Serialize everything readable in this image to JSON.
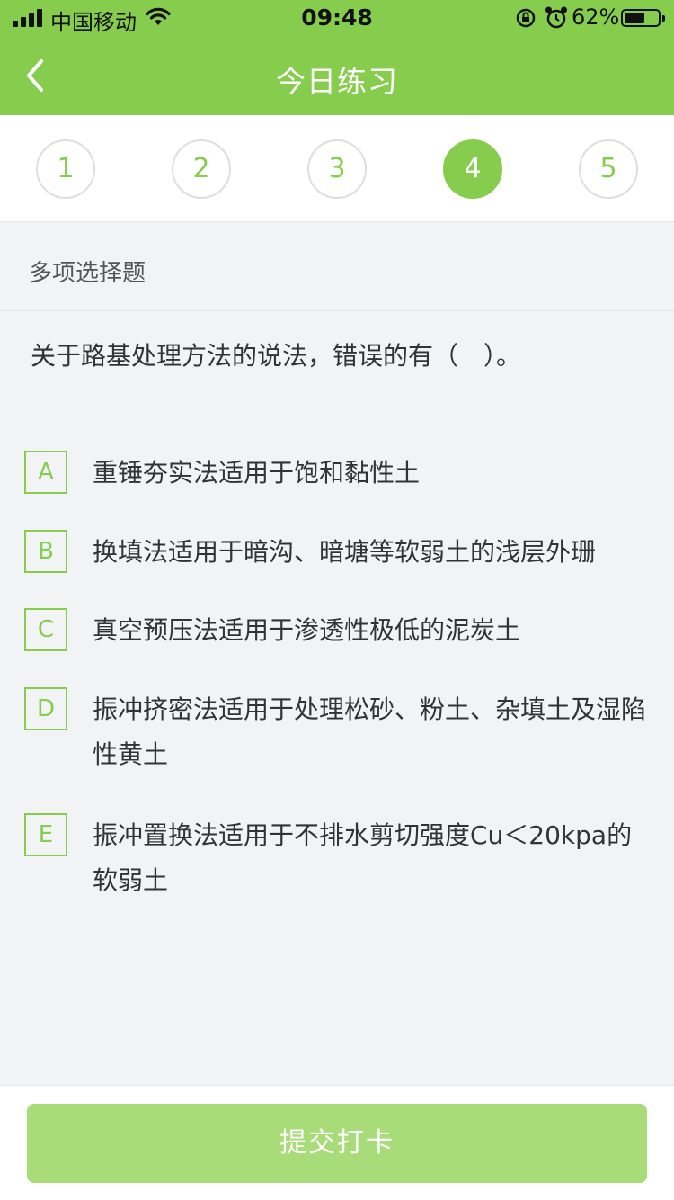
{
  "status_bar": {
    "carrier": "中国移动",
    "time": "09:48",
    "battery_percent": "62%",
    "battery_level": 0.62
  },
  "nav": {
    "title": "今日练习",
    "back_icon": "chevron-left-icon"
  },
  "question_numbers": [
    {
      "label": "1",
      "active": false
    },
    {
      "label": "2",
      "active": false
    },
    {
      "label": "3",
      "active": false
    },
    {
      "label": "4",
      "active": true
    },
    {
      "label": "5",
      "active": false
    }
  ],
  "question_type": "多项选择题",
  "question_text": "关于路基处理方法的说法，错误的有（　）。",
  "options": [
    {
      "letter": "A",
      "text": "重锤夯实法适用于饱和黏性土"
    },
    {
      "letter": "B",
      "text": "换填法适用于暗沟、暗塘等软弱土的浅层外珊"
    },
    {
      "letter": "C",
      "text": "真空预压法适用于渗透性极低的泥炭土"
    },
    {
      "letter": "D",
      "text": "振冲挤密法适用于处理松砂、粉土、杂填土及湿陷性黄土"
    },
    {
      "letter": "E",
      "text": "振冲置换法适用于不排水剪切强度Cu＜20kpa的软弱土"
    }
  ],
  "submit_label": "提交打卡",
  "colors": {
    "accent": "#86cc4d",
    "submit_disabled": "#a8dc79",
    "background": "#f2f3f5"
  }
}
